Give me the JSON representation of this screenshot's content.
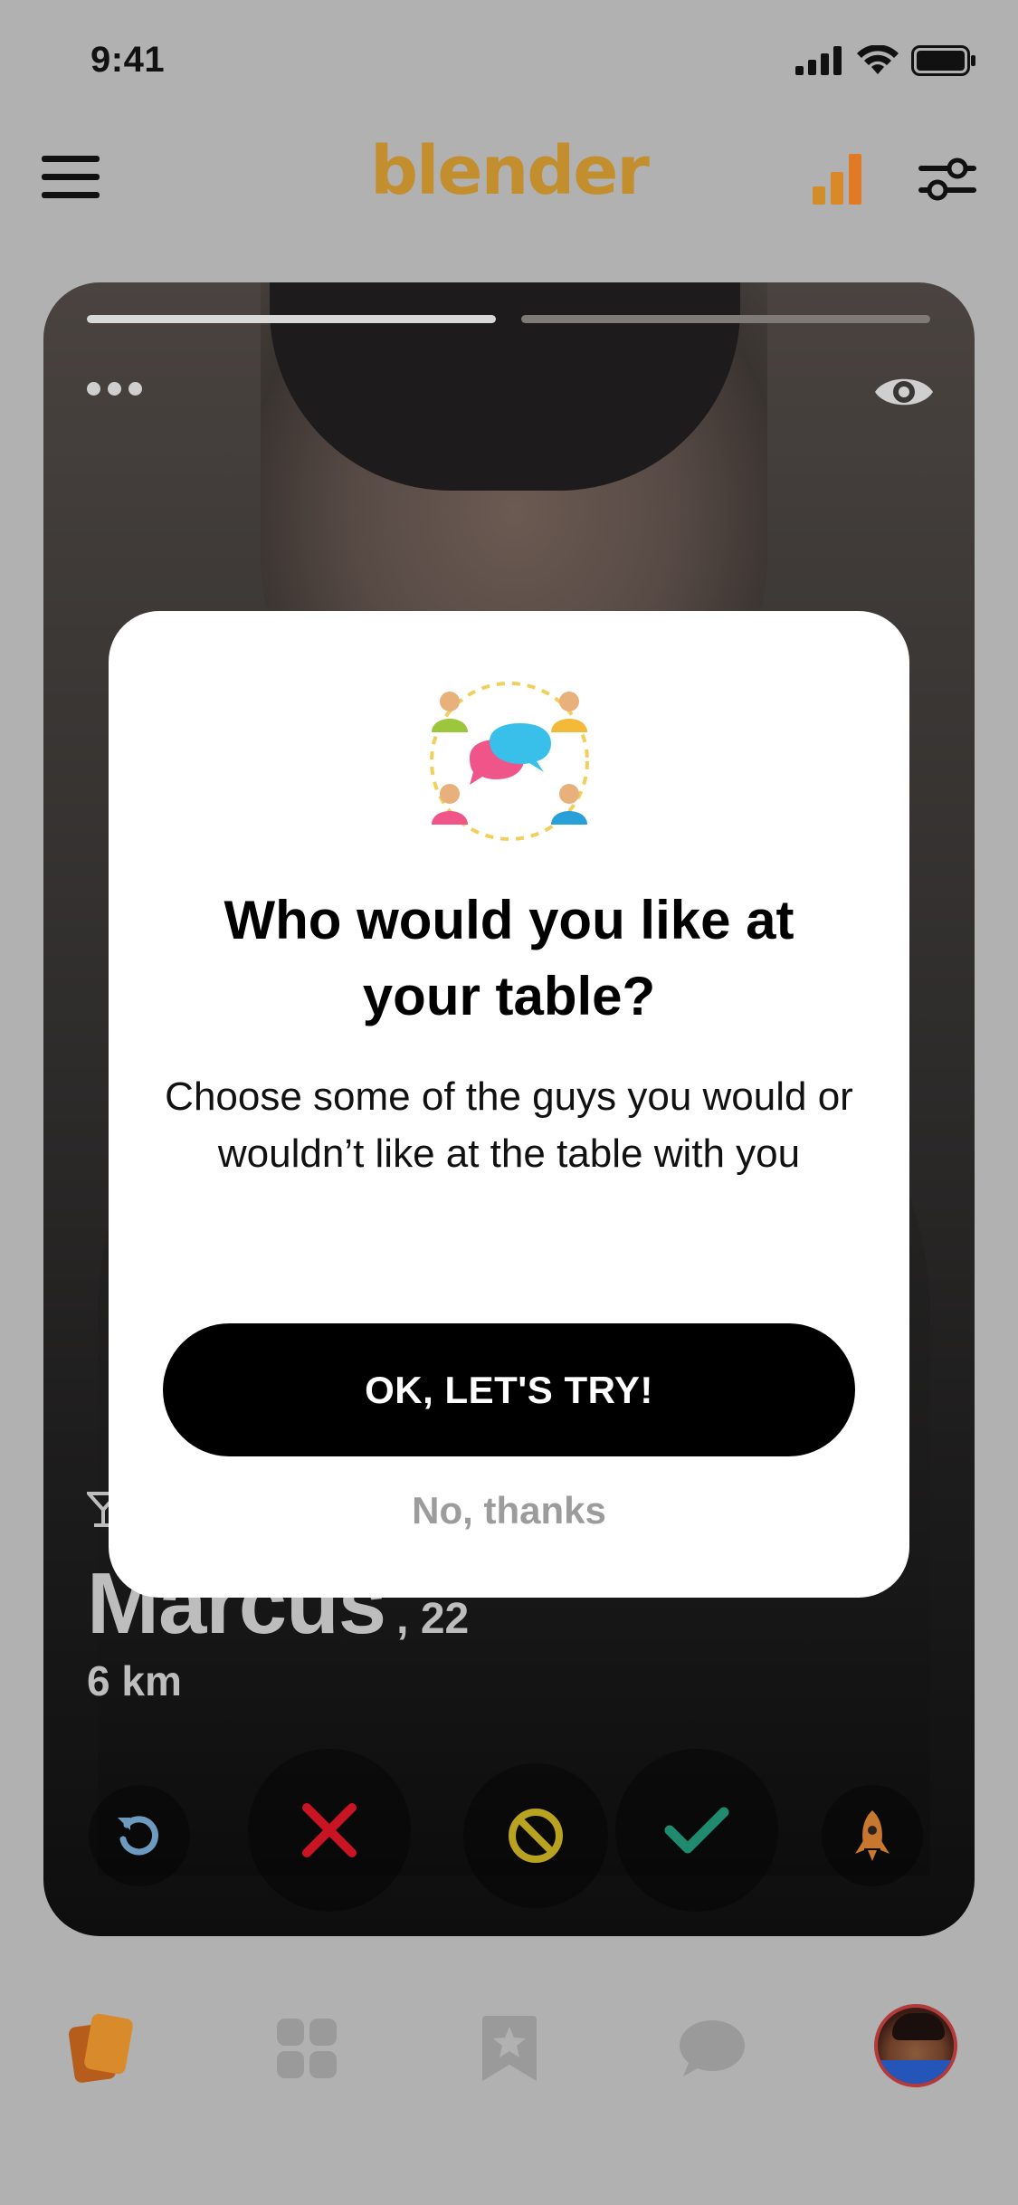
{
  "status_bar": {
    "time": "9:41"
  },
  "header": {
    "logo": "blender",
    "brand_color": "#c28e2e"
  },
  "card": {
    "name": "Marcus",
    "age": ", 22",
    "distance": "6 km",
    "photo_count": 2,
    "active_photo": 1
  },
  "actions": {
    "undo_color": "#6d9bc0",
    "nope_color": "#c91424",
    "block_color": "#b8a21f",
    "like_color": "#1f8a6e",
    "boost_color": "#c8772e"
  },
  "modal": {
    "title": "Who would you like at your table?",
    "text": "Choose some of the guys you would or wouldn’t like at the table with you",
    "ok_label": "OK, LET'S TRY!",
    "dismiss_label": "No, thanks"
  },
  "tabs": [
    {
      "name": "cards",
      "icon": "cards-icon",
      "active": true
    },
    {
      "name": "grid",
      "icon": "grid-icon",
      "active": false
    },
    {
      "name": "favorites",
      "icon": "star-bookmark-icon",
      "active": false
    },
    {
      "name": "chat",
      "icon": "chat-bubble-icon",
      "active": false
    },
    {
      "name": "profile",
      "icon": "avatar",
      "active": false
    }
  ]
}
